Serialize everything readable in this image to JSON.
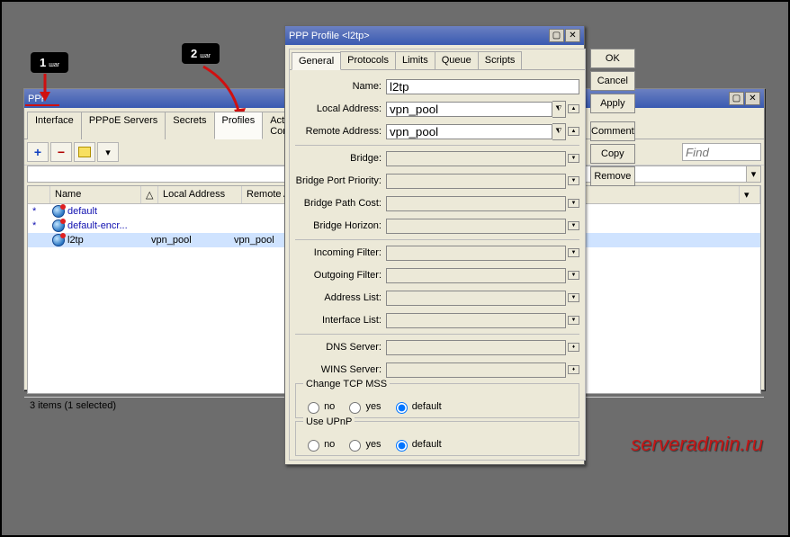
{
  "ppp": {
    "title": "PPP",
    "tabs": [
      "Interface",
      "PPPoE Servers",
      "Secrets",
      "Profiles",
      "Active Connections"
    ],
    "active_tab": 3,
    "find_placeholder": "Find",
    "columns": {
      "name": "Name",
      "local": "Local Address",
      "remote": "Remote Address"
    },
    "rows": [
      {
        "star": "*",
        "name": "default",
        "local": "",
        "remote": "",
        "cls": "default"
      },
      {
        "star": "*",
        "name": "default-encr...",
        "local": "",
        "remote": "",
        "cls": "default"
      },
      {
        "star": "",
        "name": "l2tp",
        "local": "vpn_pool",
        "remote": "vpn_pool",
        "cls": "sel"
      }
    ],
    "status": "3 items (1 selected)"
  },
  "dialog": {
    "title": "PPP Profile <l2tp>",
    "tabs": [
      "General",
      "Protocols",
      "Limits",
      "Queue",
      "Scripts"
    ],
    "active_tab": 0,
    "buttons": [
      "OK",
      "Cancel",
      "Apply",
      "Comment",
      "Copy",
      "Remove"
    ],
    "fields": {
      "name_lbl": "Name:",
      "name_val": "l2tp",
      "localaddr_lbl": "Local Address:",
      "localaddr_val": "vpn_pool",
      "remoteaddr_lbl": "Remote Address:",
      "remoteaddr_val": "vpn_pool",
      "bridge_lbl": "Bridge:",
      "bridge_val": "",
      "bpp_lbl": "Bridge Port Priority:",
      "bpp_val": "",
      "bpc_lbl": "Bridge Path Cost:",
      "bpc_val": "",
      "bh_lbl": "Bridge Horizon:",
      "bh_val": "",
      "if_lbl": "Incoming Filter:",
      "if_val": "",
      "of_lbl": "Outgoing Filter:",
      "of_val": "",
      "al_lbl": "Address List:",
      "al_val": "",
      "il_lbl": "Interface List:",
      "il_val": "",
      "dns_lbl": "DNS Server:",
      "dns_val": "",
      "wins_lbl": "WINS Server:",
      "wins_val": ""
    },
    "mss": {
      "legend": "Change TCP MSS",
      "no": "no",
      "yes": "yes",
      "def": "default",
      "sel": "default"
    },
    "upnp": {
      "legend": "Use UPnP",
      "no": "no",
      "yes": "yes",
      "def": "default",
      "sel": "default"
    }
  },
  "annotations": {
    "box1": "1",
    "box2": "2",
    "box1_sub": "шаг",
    "box2_sub": "шаг"
  },
  "watermark": "serveradmin.ru"
}
